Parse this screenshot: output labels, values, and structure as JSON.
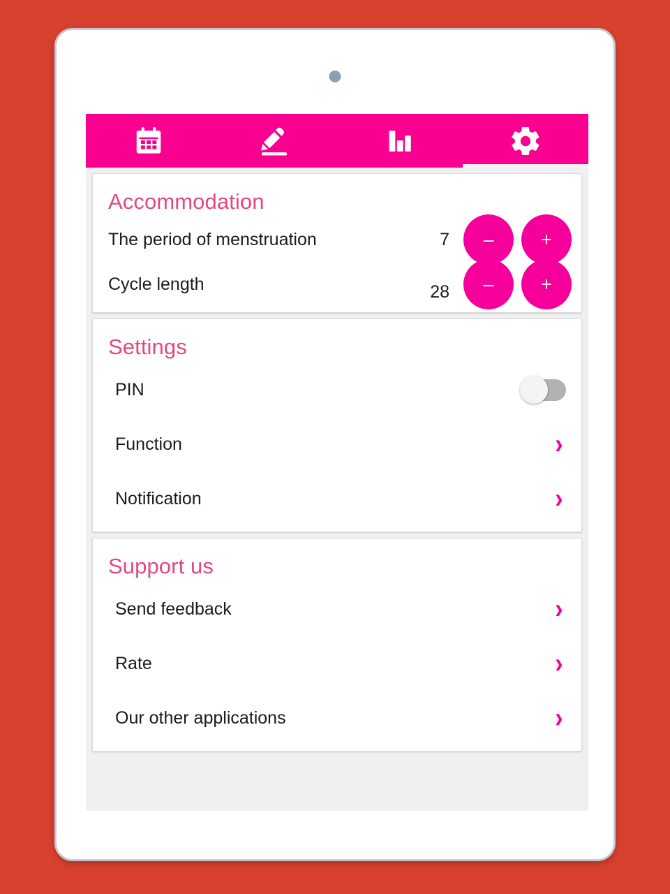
{
  "device": {
    "camera_icon": "camera-dot"
  },
  "tabs": [
    {
      "id": "calendar",
      "icon": "calendar-icon",
      "active": false
    },
    {
      "id": "edit",
      "icon": "pencil-icon",
      "active": false
    },
    {
      "id": "stats",
      "icon": "bar-chart-icon",
      "active": false
    },
    {
      "id": "settings",
      "icon": "gear-icon",
      "active": true
    }
  ],
  "accommodation": {
    "title": "Accommodation",
    "rows": [
      {
        "label": "The period of menstruation",
        "value": "7",
        "decrement_label": "–",
        "increment_label": "+"
      },
      {
        "label": "Cycle length",
        "value": "28",
        "decrement_label": "–",
        "increment_label": "+"
      }
    ]
  },
  "settings": {
    "title": "Settings",
    "pin": {
      "label": "PIN",
      "toggle_state": "off"
    },
    "rows": [
      {
        "label": "Function",
        "chevron": "›"
      },
      {
        "label": "Notification",
        "chevron": "›"
      }
    ]
  },
  "support": {
    "title": "Support us",
    "rows": [
      {
        "label": "Send feedback",
        "chevron": "›"
      },
      {
        "label": "Rate",
        "chevron": "›"
      },
      {
        "label": "Our other applications",
        "chevron": "›"
      }
    ]
  },
  "colors": {
    "page_background": "#d9412f",
    "tabbar_pink": "#fa0091",
    "accent_pink": "#f5009a",
    "heading_pink": "#e5477e",
    "card_background": "#ffffff",
    "content_background": "#f0f0f0"
  }
}
